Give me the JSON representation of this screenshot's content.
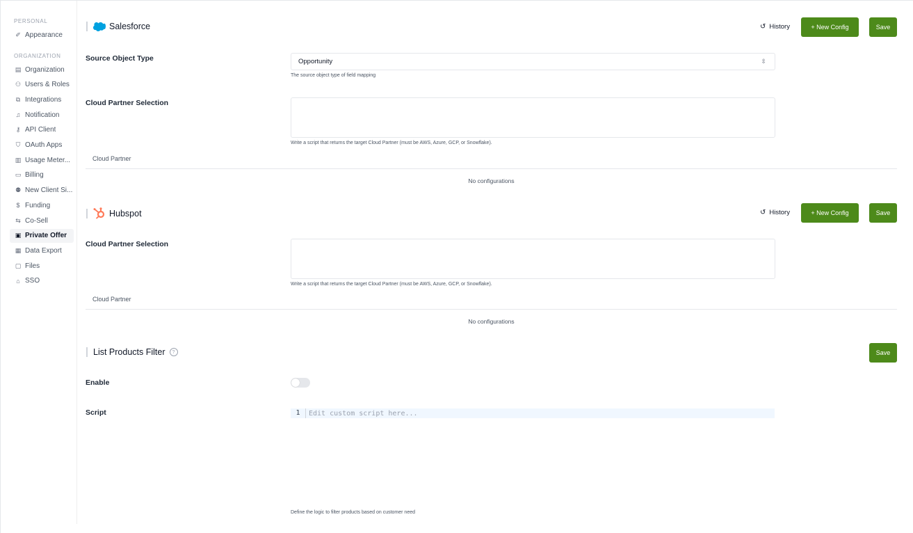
{
  "sidebar": {
    "personal_label": "PERSONAL",
    "personal_items": [
      {
        "label": "Appearance",
        "icon": "appearance-icon",
        "glyph": "✐"
      }
    ],
    "organization_label": "ORGANIZATION",
    "organization_items": [
      {
        "label": "Organization",
        "icon": "building-icon",
        "glyph": "▤"
      },
      {
        "label": "Users & Roles",
        "icon": "users-icon",
        "glyph": "⚇"
      },
      {
        "label": "Integrations",
        "icon": "link-icon",
        "glyph": "⧉"
      },
      {
        "label": "Notification",
        "icon": "bell-icon",
        "glyph": "♫"
      },
      {
        "label": "API Client",
        "icon": "key-icon",
        "glyph": "⚷"
      },
      {
        "label": "OAuth Apps",
        "icon": "shield-icon",
        "glyph": "⛉"
      },
      {
        "label": "Usage Meter...",
        "icon": "chart-icon",
        "glyph": "▥"
      },
      {
        "label": "Billing",
        "icon": "card-icon",
        "glyph": "▭"
      },
      {
        "label": "New Client Si...",
        "icon": "user-plus-icon",
        "glyph": "⚉"
      },
      {
        "label": "Funding",
        "icon": "dollar-icon",
        "glyph": "$"
      },
      {
        "label": "Co-Sell",
        "icon": "swap-icon",
        "glyph": "⇆"
      },
      {
        "label": "Private Offer",
        "icon": "document-icon",
        "glyph": "▣",
        "active": true
      },
      {
        "label": "Data Export",
        "icon": "file-export-icon",
        "glyph": "▦"
      },
      {
        "label": "Files",
        "icon": "folder-icon",
        "glyph": "▢"
      },
      {
        "label": "SSO",
        "icon": "lock-icon",
        "glyph": "⌂"
      }
    ]
  },
  "salesforce": {
    "title": "Salesforce",
    "history_label": "History",
    "new_config_label": "+ New Config",
    "save_label": "Save",
    "source_object_label": "Source Object Type",
    "source_object_value": "Opportunity",
    "source_object_help": "The source object type of field mapping",
    "cloud_partner_label": "Cloud Partner Selection",
    "cloud_partner_value": "",
    "cloud_partner_help": "Write a script that returns the target Cloud Partner (must be AWS, Azure, GCP, or Snowflake).",
    "table_header": "Cloud Partner",
    "empty_text": "No configurations"
  },
  "hubspot": {
    "title": "Hubspot",
    "history_label": "History",
    "new_config_label": "+ New Config",
    "save_label": "Save",
    "cloud_partner_label": "Cloud Partner Selection",
    "cloud_partner_value": "",
    "cloud_partner_help": "Write a script that returns the target Cloud Partner (must be AWS, Azure, GCP, or Snowflake).",
    "table_header": "Cloud Partner",
    "empty_text": "No configurations"
  },
  "list_products_filter": {
    "title": "List Products Filter",
    "save_label": "Save",
    "enable_label": "Enable",
    "enabled": false,
    "script_label": "Script",
    "line_number": "1",
    "script_placeholder": "Edit custom script here...",
    "script_help": "Define the logic to filter products based on customer need"
  },
  "colors": {
    "primary_green": "#4d8a1a",
    "salesforce_blue": "#00a1e0",
    "hubspot_orange": "#ff7a59"
  }
}
